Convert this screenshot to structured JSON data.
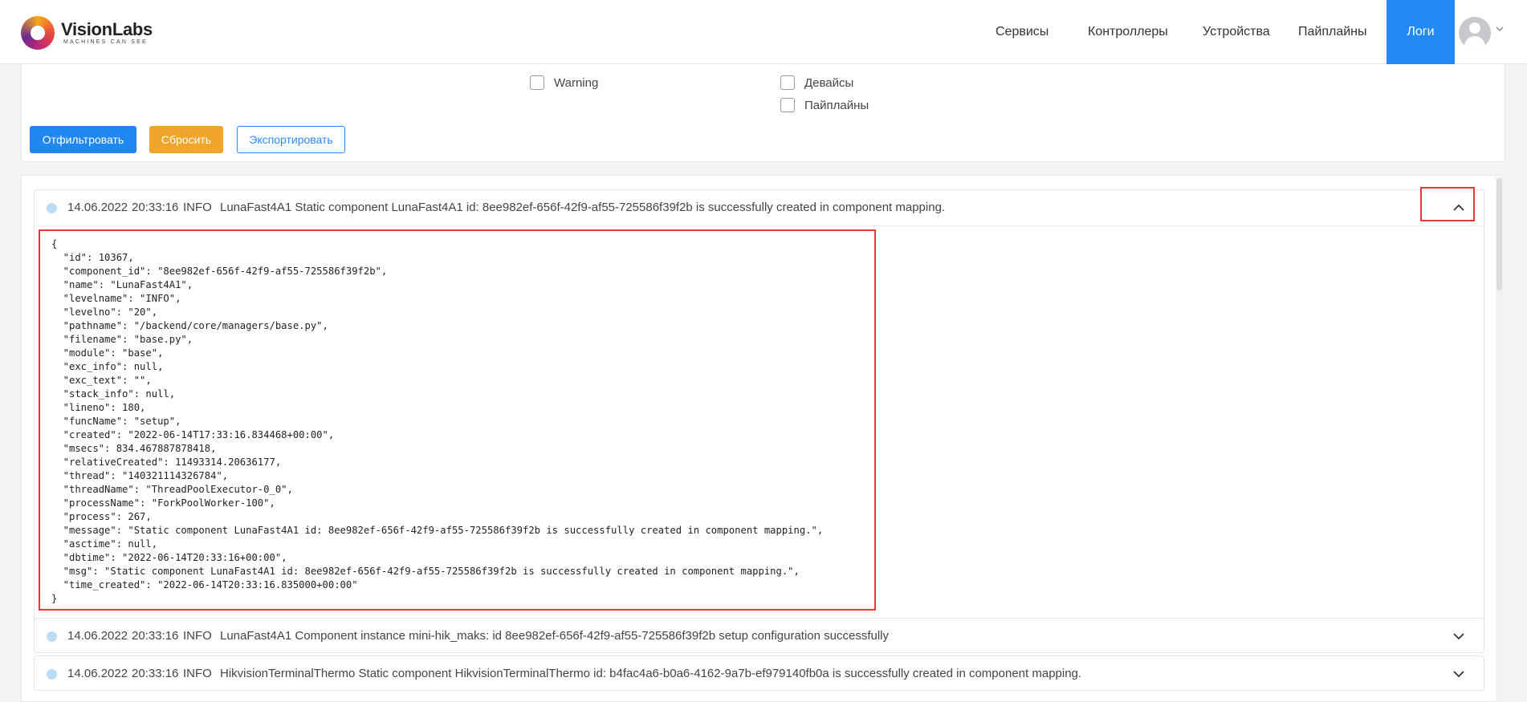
{
  "brand": {
    "name": "VisionLabs",
    "tagline": "MACHINES CAN SEE"
  },
  "nav": {
    "items": [
      "Сервисы",
      "Контроллеры",
      "Устройства",
      "Пайплайны",
      "Логи"
    ],
    "active": "Логи"
  },
  "filters": {
    "level_options": [
      "Warning"
    ],
    "source_options": [
      "Девайсы",
      "Пайплайны"
    ],
    "buttons": {
      "filter": "Отфильтровать",
      "reset": "Сбросить",
      "export": "Экспортировать"
    }
  },
  "logs": [
    {
      "date": "14.06.2022",
      "time": "20:33:16",
      "level": "INFO",
      "message": "LunaFast4A1 Static component LunaFast4A1 id: 8ee982ef-656f-42f9-af55-725586f39f2b is successfully created in component mapping.",
      "expanded": true,
      "details": "{\n  \"id\": 10367,\n  \"component_id\": \"8ee982ef-656f-42f9-af55-725586f39f2b\",\n  \"name\": \"LunaFast4A1\",\n  \"levelname\": \"INFO\",\n  \"levelno\": \"20\",\n  \"pathname\": \"/backend/core/managers/base.py\",\n  \"filename\": \"base.py\",\n  \"module\": \"base\",\n  \"exc_info\": null,\n  \"exc_text\": \"\",\n  \"stack_info\": null,\n  \"lineno\": 180,\n  \"funcName\": \"setup\",\n  \"created\": \"2022-06-14T17:33:16.834468+00:00\",\n  \"msecs\": 834.467887878418,\n  \"relativeCreated\": 11493314.20636177,\n  \"thread\": \"140321114326784\",\n  \"threadName\": \"ThreadPoolExecutor-0_0\",\n  \"processName\": \"ForkPoolWorker-100\",\n  \"process\": 267,\n  \"message\": \"Static component LunaFast4A1 id: 8ee982ef-656f-42f9-af55-725586f39f2b is successfully created in component mapping.\",\n  \"asctime\": null,\n  \"dbtime\": \"2022-06-14T20:33:16+00:00\",\n  \"msg\": \"Static component LunaFast4A1 id: 8ee982ef-656f-42f9-af55-725586f39f2b is successfully created in component mapping.\",\n  \"time_created\": \"2022-06-14T20:33:16.835000+00:00\"\n}"
    },
    {
      "date": "14.06.2022",
      "time": "20:33:16",
      "level": "INFO",
      "message": "LunaFast4A1 Component instance mini-hik_maks: id 8ee982ef-656f-42f9-af55-725586f39f2b setup configuration successfully",
      "expanded": false
    },
    {
      "date": "14.06.2022",
      "time": "20:33:16",
      "level": "INFO",
      "message": "HikvisionTerminalThermo Static component HikvisionTerminalThermo id: b4fac4a6-b0a6-4162-9a7b-ef979140fb0a is successfully created in component mapping.",
      "expanded": false
    }
  ],
  "colors": {
    "accent": "#2389f5",
    "warning_button": "#f2a52b",
    "highlight": "#e53935",
    "status_dot": "#bcdcf6"
  }
}
